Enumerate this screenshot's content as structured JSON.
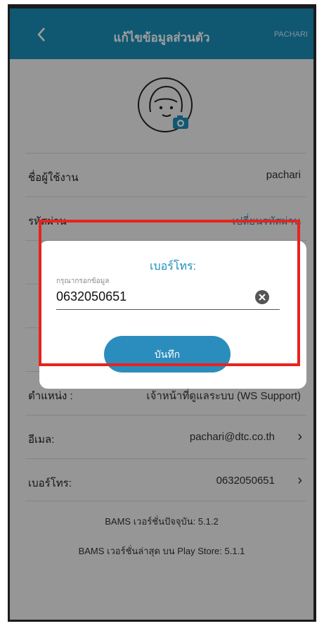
{
  "header": {
    "title": "แก้ไขข้อมูลส่วนตัว",
    "username": "PACHARI"
  },
  "rows": [
    {
      "label": "ชื่อผู้ใช้งาน",
      "value": "pachari"
    },
    {
      "label": "รหัสผ่าน",
      "value": "เปลี่ยนรหัสผ่าน"
    },
    {
      "label": "",
      "value": ""
    },
    {
      "label": "",
      "value": ""
    },
    {
      "label": "",
      "value": ""
    },
    {
      "label": "ตำแหน่ง :",
      "value": "เจ้าหน้าที่ดูแลระบบ (WS Support)"
    },
    {
      "label": "อีเมล:",
      "value": "pachari@dtc.co.th"
    },
    {
      "label": "เบอร์โทร:",
      "value": "0632050651"
    }
  ],
  "versions": {
    "current": "BAMS เวอร์ชั่นปัจจุบัน: 5.1.2",
    "latest": "BAMS เวอร์ชั่นล่าสุด บน Play Store: 5.1.1"
  },
  "dialog": {
    "title": "เบอร์โทร:",
    "hint": "กรุณากรอกข้อมูล",
    "value": "0632050651",
    "save_label": "บันทึก"
  },
  "colors": {
    "header": "#1a8fb8",
    "accent": "#1a8fb8",
    "button": "#2b8dbd",
    "highlight": "#e8231c"
  },
  "icons": [
    "back-arrow-icon",
    "avatar-camera-icon",
    "chevron-right-icon",
    "clear-icon"
  ]
}
